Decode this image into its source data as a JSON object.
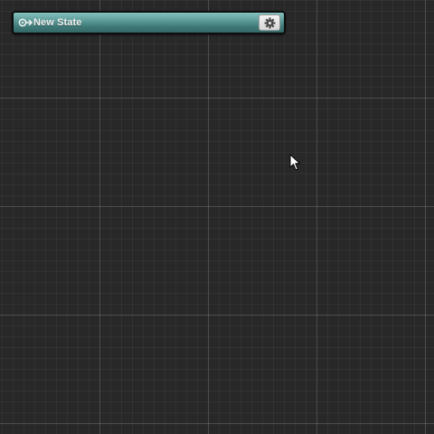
{
  "state_node": {
    "title": "New State",
    "icon": "state-link-icon",
    "settings_icon": "gear-icon",
    "color": "#4f8e8b"
  },
  "canvas": {
    "background": "#282828",
    "grid": true
  },
  "cursor": {
    "icon": "arrow-cursor-icon"
  }
}
